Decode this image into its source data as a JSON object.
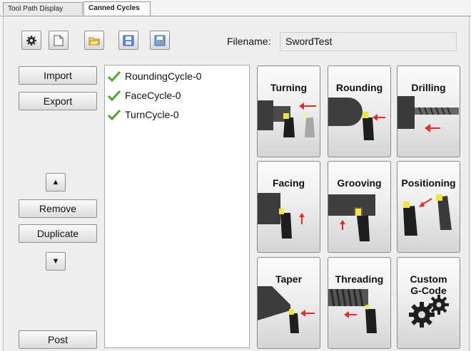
{
  "tabs": {
    "tool_path": "Tool Path Display",
    "canned": "Canned Cycles"
  },
  "toolbar": {
    "icons": [
      "gear-icon",
      "new-file-icon",
      "open-folder-icon",
      "save-icon",
      "save-as-icon"
    ]
  },
  "filename": {
    "label": "Filename:",
    "value": "SwordTest"
  },
  "left_buttons": {
    "import": "Import",
    "export": "Export",
    "up": "▲",
    "remove": "Remove",
    "duplicate": "Duplicate",
    "down": "▼",
    "post": "Post"
  },
  "cycles": [
    {
      "name": "RoundingCycle-0"
    },
    {
      "name": "FaceCycle-0"
    },
    {
      "name": "TurnCycle-0"
    }
  ],
  "tiles": [
    {
      "label": "Turning"
    },
    {
      "label": "Rounding"
    },
    {
      "label": "Drilling"
    },
    {
      "label": "Facing"
    },
    {
      "label": "Grooving"
    },
    {
      "label": "Positioning"
    },
    {
      "label": "Taper"
    },
    {
      "label": "Threading"
    },
    {
      "label": "Custom G-Code"
    }
  ],
  "colors": {
    "accent_red": "#e32b2b",
    "check_green": "#4caa2a",
    "insert_yellow": "#f1e43a"
  }
}
